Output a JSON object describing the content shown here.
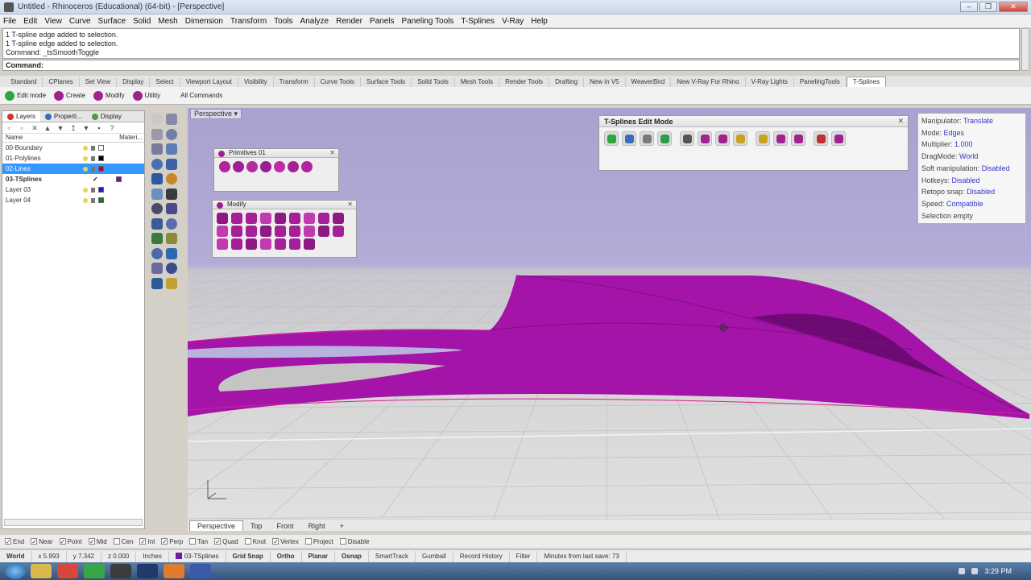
{
  "window": {
    "title": "Untitled - Rhinoceros (Educational) (64-bit) - [Perspective]",
    "buttons": [
      "–",
      "❐",
      "✕"
    ]
  },
  "menu": [
    "File",
    "Edit",
    "View",
    "Curve",
    "Surface",
    "Solid",
    "Mesh",
    "Dimension",
    "Transform",
    "Tools",
    "Analyze",
    "Render",
    "Panels",
    "Paneling Tools",
    "T-Splines",
    "V-Ray",
    "Help"
  ],
  "history": [
    "1 T-spline edge added to selection.",
    "1 T-spline edge added to selection.",
    "Command: _tsSmoothToggle"
  ],
  "command": {
    "label": "Command:",
    "value": ""
  },
  "toolbar_tabs": [
    {
      "label": "Standard",
      "active": false
    },
    {
      "label": "CPlanes",
      "active": false
    },
    {
      "label": "Set View",
      "active": false
    },
    {
      "label": "Display",
      "active": false
    },
    {
      "label": "Select",
      "active": false
    },
    {
      "label": "Viewport Layout",
      "active": false
    },
    {
      "label": "Visibility",
      "active": false
    },
    {
      "label": "Transform",
      "active": false
    },
    {
      "label": "Curve Tools",
      "active": false
    },
    {
      "label": "Surface Tools",
      "active": false
    },
    {
      "label": "Solid Tools",
      "active": false
    },
    {
      "label": "Mesh Tools",
      "active": false
    },
    {
      "label": "Render Tools",
      "active": false
    },
    {
      "label": "Drafting",
      "active": false
    },
    {
      "label": "New in V5",
      "active": false
    },
    {
      "label": "WeaverBird",
      "active": false
    },
    {
      "label": "New V-Ray For Rhino",
      "active": false
    },
    {
      "label": "V-Ray Lights",
      "active": false
    },
    {
      "label": "PanelingTools",
      "active": false
    },
    {
      "label": "T-Splines",
      "active": true
    }
  ],
  "tsplines_toolbar": [
    {
      "label": "Edit mode",
      "icon": "power-icon"
    },
    {
      "label": "Create",
      "icon": "sphere-icon"
    },
    {
      "label": "Modify",
      "icon": "modify-icon"
    },
    {
      "label": "Utility",
      "icon": "utility-icon"
    },
    {
      "label": "All Commands",
      "icon": "list-icon"
    }
  ],
  "left_panel": {
    "tabs": [
      {
        "label": "Layers",
        "active": true,
        "color": "#d9302c"
      },
      {
        "label": "Properti...",
        "active": false,
        "color": "#3a6fb8"
      },
      {
        "label": "Display",
        "active": false,
        "color": "#4e9a3f"
      }
    ],
    "header": {
      "name": "Name",
      "material": "Materi..."
    },
    "layers": [
      {
        "name": "00-Boundary",
        "color": "#ffffff",
        "selected": false,
        "bold": false,
        "current": false
      },
      {
        "name": "01-Polylines",
        "color": "#000000",
        "selected": false,
        "bold": false,
        "current": false
      },
      {
        "name": "02-Lines",
        "color": "#c0002a",
        "selected": true,
        "bold": false,
        "current": false
      },
      {
        "name": "03-TSplines",
        "color": "#6a1ea0",
        "selected": false,
        "bold": true,
        "current": true
      },
      {
        "name": "Layer 03",
        "color": "#1a1acc",
        "selected": false,
        "bold": false,
        "current": false
      },
      {
        "name": "Layer 04",
        "color": "#1a7a1a",
        "selected": false,
        "bold": false,
        "current": false
      }
    ]
  },
  "viewport": {
    "label": "Perspective",
    "dropdown_glyph": "▾",
    "tabs": [
      {
        "label": "Perspective",
        "active": true
      },
      {
        "label": "Top",
        "active": false
      },
      {
        "label": "Front",
        "active": false
      },
      {
        "label": "Right",
        "active": false
      },
      {
        "label": "+",
        "active": false
      }
    ]
  },
  "primitives_panel": {
    "title": "Primitives 01",
    "close": "✕"
  },
  "modify_panel": {
    "title": "Modify",
    "close": "✕"
  },
  "tsplines_edit_mode": {
    "title": "T-Splines Edit Mode",
    "close": "✕",
    "icon_colors": [
      "#2ea63b",
      "#3a6fb8",
      "#7a7a7a",
      "#2c9e4a",
      "#555555",
      "#a0228e",
      "#a0228e",
      "#c8a21e",
      "#c8a21e",
      "#a0228e",
      "#a0228e",
      "#c03030",
      "#a0228e"
    ]
  },
  "info": [
    {
      "key": "Manipulator:",
      "value": "Translate"
    },
    {
      "key": "Mode:",
      "value": "Edges"
    },
    {
      "key": "Multiplier:",
      "value": "1.000"
    },
    {
      "key": "DragMode:",
      "value": "World"
    },
    {
      "key": "Soft manipulation:",
      "value": "Disabled"
    },
    {
      "key": "Hotkeys:",
      "value": "Disabled"
    },
    {
      "key": "Retopo snap:",
      "value": "Disabled"
    },
    {
      "key": "Speed:",
      "value": "Compatible"
    },
    {
      "key": "Selection empty",
      "value": ""
    }
  ],
  "osnaps": [
    {
      "label": "End",
      "checked": true
    },
    {
      "label": "Near",
      "checked": true
    },
    {
      "label": "Point",
      "checked": true
    },
    {
      "label": "Mid",
      "checked": true
    },
    {
      "label": "Cen",
      "checked": false
    },
    {
      "label": "Int",
      "checked": true
    },
    {
      "label": "Perp",
      "checked": true
    },
    {
      "label": "Tan",
      "checked": false
    },
    {
      "label": "Quad",
      "checked": true
    },
    {
      "label": "Knot",
      "checked": false
    },
    {
      "label": "Vertex",
      "checked": true
    },
    {
      "label": "Project",
      "checked": false
    },
    {
      "label": "Disable",
      "checked": false
    }
  ],
  "status": {
    "cplane": "World",
    "x": "x 5.993",
    "y": "y 7.342",
    "z": "z 0.000",
    "units": "Inches",
    "layer": "03-TSplines",
    "layer_color": "#6a1ea0",
    "toggles": [
      {
        "label": "Grid Snap",
        "bold": true
      },
      {
        "label": "Ortho",
        "bold": true
      },
      {
        "label": "Planar",
        "bold": true
      },
      {
        "label": "Osnap",
        "bold": true
      },
      {
        "label": "SmartTrack",
        "bold": false
      },
      {
        "label": "Gumball",
        "bold": false
      },
      {
        "label": "Record History",
        "bold": false
      },
      {
        "label": "Filter",
        "bold": false
      }
    ],
    "message": "Minutes from last save: 73"
  },
  "taskbar": {
    "apps": [
      "explorer-icon",
      "chrome-icon",
      "rhino-green-icon",
      "vmware-icon",
      "terminal-icon",
      "paint-icon",
      "settings-icon"
    ],
    "app_colors": [
      "#d9b94a",
      "#d9463c",
      "#3aa64a",
      "#3c3c3c",
      "#223a6a",
      "#e07a2e",
      "#3a5ca8"
    ],
    "clock": "3:29 PM"
  }
}
